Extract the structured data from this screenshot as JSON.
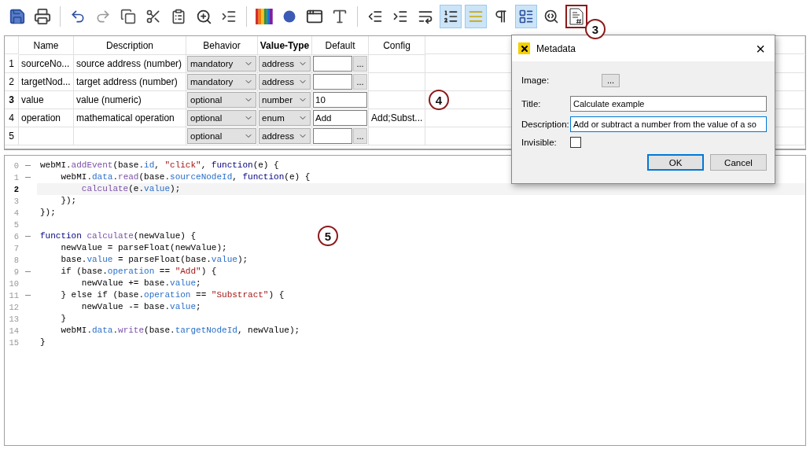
{
  "toolbar": [
    {
      "kind": "save",
      "selected": false,
      "marked": false
    },
    {
      "kind": "print",
      "selected": false,
      "marked": false
    },
    {
      "kind": "undo",
      "group_start": true,
      "selected": false,
      "marked": false
    },
    {
      "kind": "redo",
      "selected": false,
      "marked": false
    },
    {
      "kind": "copy",
      "selected": false,
      "marked": false
    },
    {
      "kind": "cut",
      "selected": false,
      "marked": false
    },
    {
      "kind": "paste",
      "selected": false,
      "marked": false
    },
    {
      "kind": "zoom",
      "selected": false,
      "marked": false
    },
    {
      "kind": "insert",
      "selected": false,
      "marked": false
    },
    {
      "kind": "colors",
      "group_start": true,
      "selected": false,
      "marked": false
    },
    {
      "kind": "dot",
      "selected": false,
      "marked": false
    },
    {
      "kind": "window",
      "selected": false,
      "marked": false
    },
    {
      "kind": "font",
      "selected": false,
      "marked": false
    },
    {
      "kind": "outdent",
      "group_start": true,
      "selected": false,
      "marked": false
    },
    {
      "kind": "indent",
      "selected": false,
      "marked": false
    },
    {
      "kind": "wrap",
      "selected": false,
      "marked": false
    },
    {
      "kind": "numbered",
      "selected": true,
      "marked": false
    },
    {
      "kind": "highlight",
      "selected": true,
      "marked": false
    },
    {
      "kind": "pilcrow",
      "selected": false,
      "marked": false
    },
    {
      "kind": "layout",
      "selected": true,
      "marked": false
    },
    {
      "kind": "inspect",
      "selected": false,
      "marked": false
    },
    {
      "kind": "metadata",
      "selected": false,
      "marked": true
    }
  ],
  "callouts": [
    "3",
    "4",
    "5"
  ],
  "table": {
    "columns": [
      {
        "label": "Name",
        "bold": false
      },
      {
        "label": "Description",
        "bold": false
      },
      {
        "label": "Behavior",
        "bold": false
      },
      {
        "label": "Value-Type",
        "bold": true
      },
      {
        "label": "Default",
        "bold": false
      },
      {
        "label": "Config",
        "bold": false
      }
    ],
    "rows": [
      {
        "number": "1",
        "current": false,
        "name": "sourceNo...",
        "description": "source address (number)",
        "behavior": "mandatory",
        "value_type": "address",
        "default": "",
        "browse": "...",
        "config": ""
      },
      {
        "number": "2",
        "current": false,
        "name": "targetNod...",
        "description": "target address (number)",
        "behavior": "mandatory",
        "value_type": "address",
        "default": "",
        "browse": "...",
        "config": ""
      },
      {
        "number": "3",
        "current": true,
        "name": "value",
        "description": "value (numeric)",
        "behavior": "optional",
        "value_type": "number",
        "default": "10",
        "config": ""
      },
      {
        "number": "4",
        "current": false,
        "name": "operation",
        "description": "mathematical operation",
        "behavior": "optional",
        "value_type": "enum",
        "default": "Add",
        "config": "Add;Subst..."
      },
      {
        "number": "5",
        "current": false,
        "name": "",
        "description": "",
        "behavior": "optional",
        "value_type": "address",
        "default": "",
        "browse": "...",
        "config": ""
      }
    ]
  },
  "editor": {
    "lines": [
      {
        "number": "0",
        "fold": true,
        "current": false,
        "tokens": [
          {
            "kind": "plain",
            "text": "webMI."
          },
          {
            "kind": "method",
            "text": "addEvent"
          },
          {
            "kind": "plain",
            "text": "(base."
          },
          {
            "kind": "property",
            "text": "id"
          },
          {
            "kind": "plain",
            "text": ", "
          },
          {
            "kind": "string",
            "text": "\"click\""
          },
          {
            "kind": "plain",
            "text": ", "
          },
          {
            "kind": "keyword",
            "text": "function"
          },
          {
            "kind": "plain",
            "text": "(e) {"
          }
        ]
      },
      {
        "number": "1",
        "fold": true,
        "current": false,
        "tokens": [
          {
            "kind": "plain",
            "text": "    webMI."
          },
          {
            "kind": "property",
            "text": "data"
          },
          {
            "kind": "plain",
            "text": "."
          },
          {
            "kind": "method",
            "text": "read"
          },
          {
            "kind": "plain",
            "text": "(base."
          },
          {
            "kind": "property",
            "text": "sourceNodeId"
          },
          {
            "kind": "plain",
            "text": ", "
          },
          {
            "kind": "keyword",
            "text": "function"
          },
          {
            "kind": "plain",
            "text": "(e) {"
          }
        ]
      },
      {
        "number": "2",
        "fold": false,
        "current": true,
        "tokens": [
          {
            "kind": "method",
            "text": "        calculate"
          },
          {
            "kind": "plain",
            "text": "(e."
          },
          {
            "kind": "property",
            "text": "value"
          },
          {
            "kind": "plain",
            "text": ");"
          }
        ]
      },
      {
        "number": "3",
        "fold": false,
        "current": false,
        "tokens": [
          {
            "kind": "plain",
            "text": "    });"
          }
        ]
      },
      {
        "number": "4",
        "fold": false,
        "current": false,
        "tokens": [
          {
            "kind": "plain",
            "text": "});"
          }
        ]
      },
      {
        "number": "5",
        "fold": false,
        "current": false
      },
      {
        "number": "6",
        "fold": true,
        "current": false,
        "tokens": [
          {
            "kind": "keyword",
            "text": "function "
          },
          {
            "kind": "method",
            "text": "calculate"
          },
          {
            "kind": "plain",
            "text": "(newValue) {"
          }
        ]
      },
      {
        "number": "7",
        "fold": false,
        "current": false,
        "tokens": [
          {
            "kind": "plain",
            "text": "    newValue = parseFloat(newValue);"
          }
        ]
      },
      {
        "number": "8",
        "fold": false,
        "current": false,
        "tokens": [
          {
            "kind": "plain",
            "text": "    base."
          },
          {
            "kind": "property",
            "text": "value"
          },
          {
            "kind": "plain",
            "text": " = parseFloat(base."
          },
          {
            "kind": "property",
            "text": "value"
          },
          {
            "kind": "plain",
            "text": ");"
          }
        ]
      },
      {
        "number": "9",
        "fold": true,
        "current": false,
        "tokens": [
          {
            "kind": "plain",
            "text": "    if (base."
          },
          {
            "kind": "property",
            "text": "operation"
          },
          {
            "kind": "plain",
            "text": " == "
          },
          {
            "kind": "string",
            "text": "\"Add\""
          },
          {
            "kind": "plain",
            "text": ") {"
          }
        ]
      },
      {
        "number": "10",
        "fold": false,
        "current": false,
        "tokens": [
          {
            "kind": "plain",
            "text": "        newValue += base."
          },
          {
            "kind": "property",
            "text": "value"
          },
          {
            "kind": "plain",
            "text": ";"
          }
        ]
      },
      {
        "number": "11",
        "fold": true,
        "current": false,
        "tokens": [
          {
            "kind": "plain",
            "text": "    } else if (base."
          },
          {
            "kind": "property",
            "text": "operation"
          },
          {
            "kind": "plain",
            "text": " == "
          },
          {
            "kind": "string",
            "text": "\"Substract\""
          },
          {
            "kind": "plain",
            "text": ") {"
          }
        ]
      },
      {
        "number": "12",
        "fold": false,
        "current": false,
        "tokens": [
          {
            "kind": "plain",
            "text": "        newValue -= base."
          },
          {
            "kind": "property",
            "text": "value"
          },
          {
            "kind": "plain",
            "text": ";"
          }
        ]
      },
      {
        "number": "13",
        "fold": false,
        "current": false,
        "tokens": [
          {
            "kind": "plain",
            "text": "    }"
          }
        ]
      },
      {
        "number": "14",
        "fold": false,
        "current": false,
        "tokens": [
          {
            "kind": "plain",
            "text": "    webMI."
          },
          {
            "kind": "property",
            "text": "data"
          },
          {
            "kind": "plain",
            "text": "."
          },
          {
            "kind": "method",
            "text": "write"
          },
          {
            "kind": "plain",
            "text": "(base."
          },
          {
            "kind": "property",
            "text": "targetNodeId"
          },
          {
            "kind": "plain",
            "text": ", newValue);"
          }
        ]
      },
      {
        "number": "15",
        "fold": false,
        "current": false,
        "tokens": [
          {
            "kind": "plain",
            "text": "}"
          }
        ]
      }
    ]
  },
  "dialog": {
    "title": "Metadata",
    "close": "×",
    "image_label": "Image:",
    "image_button": "...",
    "title_label": "Title:",
    "title_value": "Calculate example",
    "description_label": "Description:",
    "description_value": "Add or subtract a number from the value of a so",
    "invisible_label": "Invisible:",
    "invisible_checked": false,
    "buttons": [
      "OK",
      "Cancel"
    ]
  }
}
